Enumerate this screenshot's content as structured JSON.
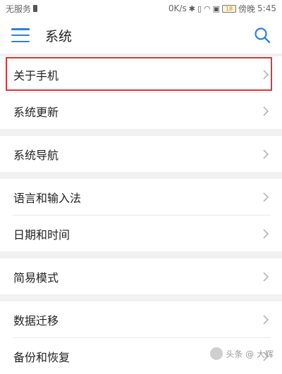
{
  "status_bar": {
    "carrier": "无服务",
    "speed": "0K/s",
    "battery": "18",
    "time_prefix": "傍晚",
    "time": "5:45"
  },
  "app_bar": {
    "title": "系统",
    "menu_icon": "menu-icon",
    "search_icon": "search-icon",
    "accent_color": "#2f7fe0"
  },
  "settings": {
    "items": [
      {
        "label": "关于手机"
      },
      {
        "label": "系统更新"
      },
      {
        "label": "系统导航"
      },
      {
        "label": "语言和输入法"
      },
      {
        "label": "日期和时间"
      },
      {
        "label": "简易模式"
      },
      {
        "label": "数据迁移"
      },
      {
        "label": "备份和恢复"
      }
    ]
  },
  "highlight_color": "#d9363e",
  "watermark": "头条 @ 大辉"
}
